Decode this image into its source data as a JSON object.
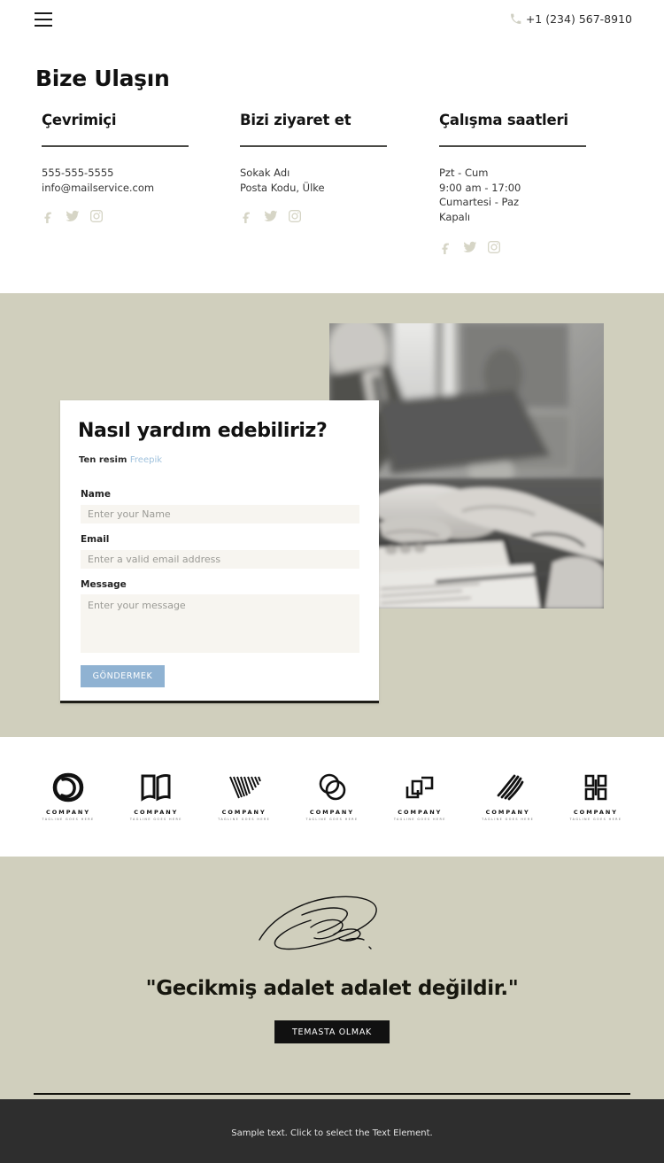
{
  "header": {
    "menu_icon": "hamburger-icon",
    "phone_icon": "phone-icon",
    "phone": "+1 (234) 567-8910"
  },
  "page_title": "Bize Ulaşın",
  "columns": [
    {
      "heading": "Çevrimiçi",
      "lines": [
        "555-555-5555",
        "info@mailservice.com"
      ],
      "socials": [
        "facebook-icon",
        "twitter-icon",
        "instagram-icon"
      ]
    },
    {
      "heading": "Bizi ziyaret et",
      "lines": [
        "Sokak Adı",
        "Posta Kodu, Ülke"
      ],
      "socials": [
        "facebook-icon",
        "twitter-icon",
        "instagram-icon"
      ]
    },
    {
      "heading": "Çalışma saatleri",
      "lines": [
        "Pzt - Cum",
        "9:00 am - 17:00",
        "Cumartesi - Paz",
        "Kapalı"
      ],
      "socials": [
        "facebook-icon",
        "twitter-icon",
        "instagram-icon"
      ]
    }
  ],
  "form": {
    "title": "Nasıl yardım edebiliriz?",
    "credit_prefix": "Ten resim",
    "credit_link": "Freepik",
    "name_label": "Name",
    "name_placeholder": "Enter your Name",
    "name_value": "",
    "email_label": "Email",
    "email_placeholder": "Enter a valid email address",
    "email_value": "",
    "message_label": "Message",
    "message_placeholder": "Enter your message",
    "message_value": "",
    "submit_label": "GÖNDERMEK",
    "submit_color": "#8fb2d2"
  },
  "photo": {
    "alt": "handshake-photo"
  },
  "logos": [
    {
      "mark": "oval-swirl-logo",
      "name": "COMPANY",
      "tagline": "TAGLINE GOES HERE"
    },
    {
      "mark": "open-book-logo",
      "name": "COMPANY",
      "tagline": "TAGLINE GOES HERE"
    },
    {
      "mark": "striped-v-logo",
      "name": "COMPANY",
      "tagline": "TAGLINE GOES HERE"
    },
    {
      "mark": "interlocking-circles-logo",
      "name": "COMPANY",
      "tagline": "TAGLINE GOES HERE"
    },
    {
      "mark": "overlapping-squares-logo",
      "name": "COMPANY",
      "tagline": "TAGLINE GOES HERE"
    },
    {
      "mark": "diagonal-stripes-logo",
      "name": "COMPANY",
      "tagline": "TAGLINE GOES HERE"
    },
    {
      "mark": "split-blocks-logo",
      "name": "COMPANY",
      "tagline": "TAGLINE GOES HERE"
    }
  ],
  "quote_section": {
    "signature": "signature-mark",
    "quote": "\"Gecikmiş adalet adalet değildir.\"",
    "cta_label": "TEMASTA OLMAK"
  },
  "footer": {
    "text": "Sample text. Click to select the Text Element."
  },
  "colors": {
    "beige": "#d0cfbd",
    "dark": "#2e2e2e",
    "accent_blue": "#8fb2d2",
    "social_gray": "#d6d5c6"
  }
}
